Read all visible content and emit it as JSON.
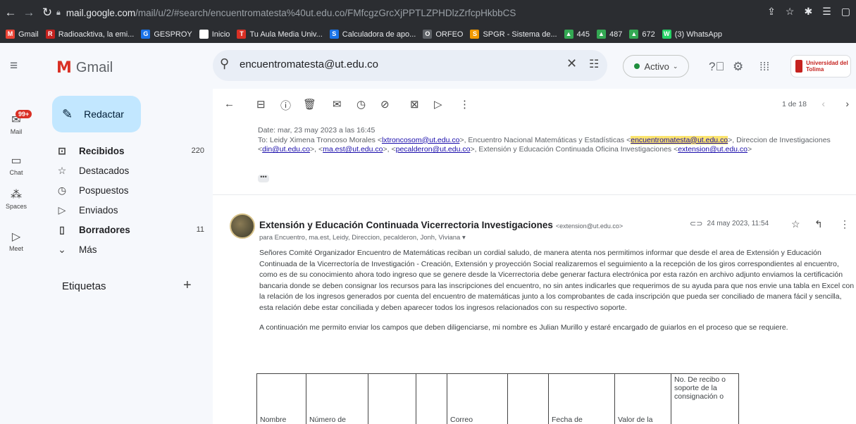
{
  "browser": {
    "url_host": "mail.google.com",
    "url_path": "/mail/u/2/#search/encuentromatesta%40ut.edu.co/FMfcgzGrcXjPPTLZPHDlzZrfcpHkbbCS",
    "bookmarks": [
      {
        "label": "Gmail",
        "color": "#ea4335",
        "glyph": "M"
      },
      {
        "label": "Radioacktiva, la emi...",
        "color": "#c5221f",
        "glyph": "R"
      },
      {
        "label": "GESPROY",
        "color": "#1a73e8",
        "glyph": "G"
      },
      {
        "label": "Inicio",
        "color": "#ffffff",
        "glyph": ""
      },
      {
        "label": "Tu Aula Media Univ...",
        "color": "#d93025",
        "glyph": "T"
      },
      {
        "label": "Calculadora de apo...",
        "color": "#1a73e8",
        "glyph": "S"
      },
      {
        "label": "ORFEO",
        "color": "#5f6368",
        "glyph": "O"
      },
      {
        "label": "SPGR - Sistema de...",
        "color": "#f29900",
        "glyph": "S"
      },
      {
        "label": "445",
        "color": "#34a853",
        "glyph": "▲"
      },
      {
        "label": "487",
        "color": "#34a853",
        "glyph": "▲"
      },
      {
        "label": "672",
        "color": "#34a853",
        "glyph": "▲"
      },
      {
        "label": "(3) WhatsApp",
        "color": "#25d366",
        "glyph": "W"
      }
    ]
  },
  "header": {
    "app_name": "Gmail",
    "search_value": "encuentromatesta@ut.edu.co",
    "status": "Activo",
    "university": "Universidad del Tolima"
  },
  "rail": {
    "mail_badge": "99+",
    "items": [
      "Mail",
      "Chat",
      "Spaces",
      "Meet"
    ]
  },
  "sidebar": {
    "compose": "Redactar",
    "items": [
      {
        "label": "Recibidos",
        "count": "220",
        "bold": true
      },
      {
        "label": "Destacados",
        "count": "",
        "bold": false
      },
      {
        "label": "Pospuestos",
        "count": "",
        "bold": false
      },
      {
        "label": "Enviados",
        "count": "",
        "bold": false
      },
      {
        "label": "Borradores",
        "count": "11",
        "bold": true
      },
      {
        "label": "Más",
        "count": "",
        "bold": false
      }
    ],
    "labels_title": "Etiquetas"
  },
  "toolbar": {
    "pager": "1 de 18"
  },
  "quoted": {
    "date_line": "Date: mar, 23 may 2023 a las 16:45",
    "to_prefix": "To: Leidy Ximena Troncoso Morales <",
    "to_email1": "lxtroncosom@ut.edu.co",
    "to_mid1": ">, Encuentro Nacional Matemáticas y Estadísticas <",
    "to_email2": "encuentromatesta@ut.edu.co",
    "to_mid2": ">, Direccion de Investigaciones <",
    "to_email3": "din@ut.edu.co",
    "to_mid3": ">, <",
    "to_email4": "ma.est@ut.edu.co",
    "to_mid4": ">, <",
    "to_email5": "pecalderon@ut.edu.co",
    "to_mid5": ">, Extensión y Educación Continuada Oficina Investigaciones <",
    "to_email6": "extension@ut.edu.co",
    "to_end": ">"
  },
  "message": {
    "sender": "Extensión y Educación Continuada Vicerrectoria Investigaciones",
    "sender_email": "<extension@ut.edu.co>",
    "recipients": "para Encuentro, ma.est, Leidy, Direccion, pecalderon, Jonh, Viviana",
    "date": "24 may 2023, 11:54",
    "para1": "Señores Comité Organizador Encuentro de Matemáticas reciban un cordial saludo, de manera atenta nos permitimos informar que desde el  area de Extensión y Educación Continuada de la Vicerrectoría de Investigación - Creación, Extensión y proyección Social realizaremos el seguimiento a la recepción de los giros correspondientes al encuentro, como es de su conocimiento ahora todo ingreso que se genere desde la Vicerrectoria debe generar factura electrónica por esta razón en archivo adjunto enviamos la certificación bancaria donde se deben consignar los recursos para las inscripciones del encuentro, no sin antes indicarles que requerimos de su ayuda para que nos envie una tabla en Excel con la relación de los ingresos generados por cuenta del encuentro de matemáticas junto a los comprobantes de cada inscripción que pueda ser conciliado de manera fácil y sencilla, esta relación debe estar conciliada y deben aparecer todos los ingresos relacionados con su respectivo soporte.",
    "para2": "A continuación me permito enviar los campos que deben diligenciarse, mi nombre es Julian Murillo y estaré encargado de guiarlos en el proceso que se requiere.",
    "table_headers": [
      "Nombre",
      "Número de",
      "",
      "",
      "Correo",
      "",
      "Fecha de",
      "Valor de la",
      "No. De recibo o soporte de la consignación o"
    ]
  },
  "colors": {
    "accent": "#0b57d0",
    "compose_bg": "#c2e7ff",
    "highlight": "#fbe46e",
    "brand_red": "#d93025"
  }
}
